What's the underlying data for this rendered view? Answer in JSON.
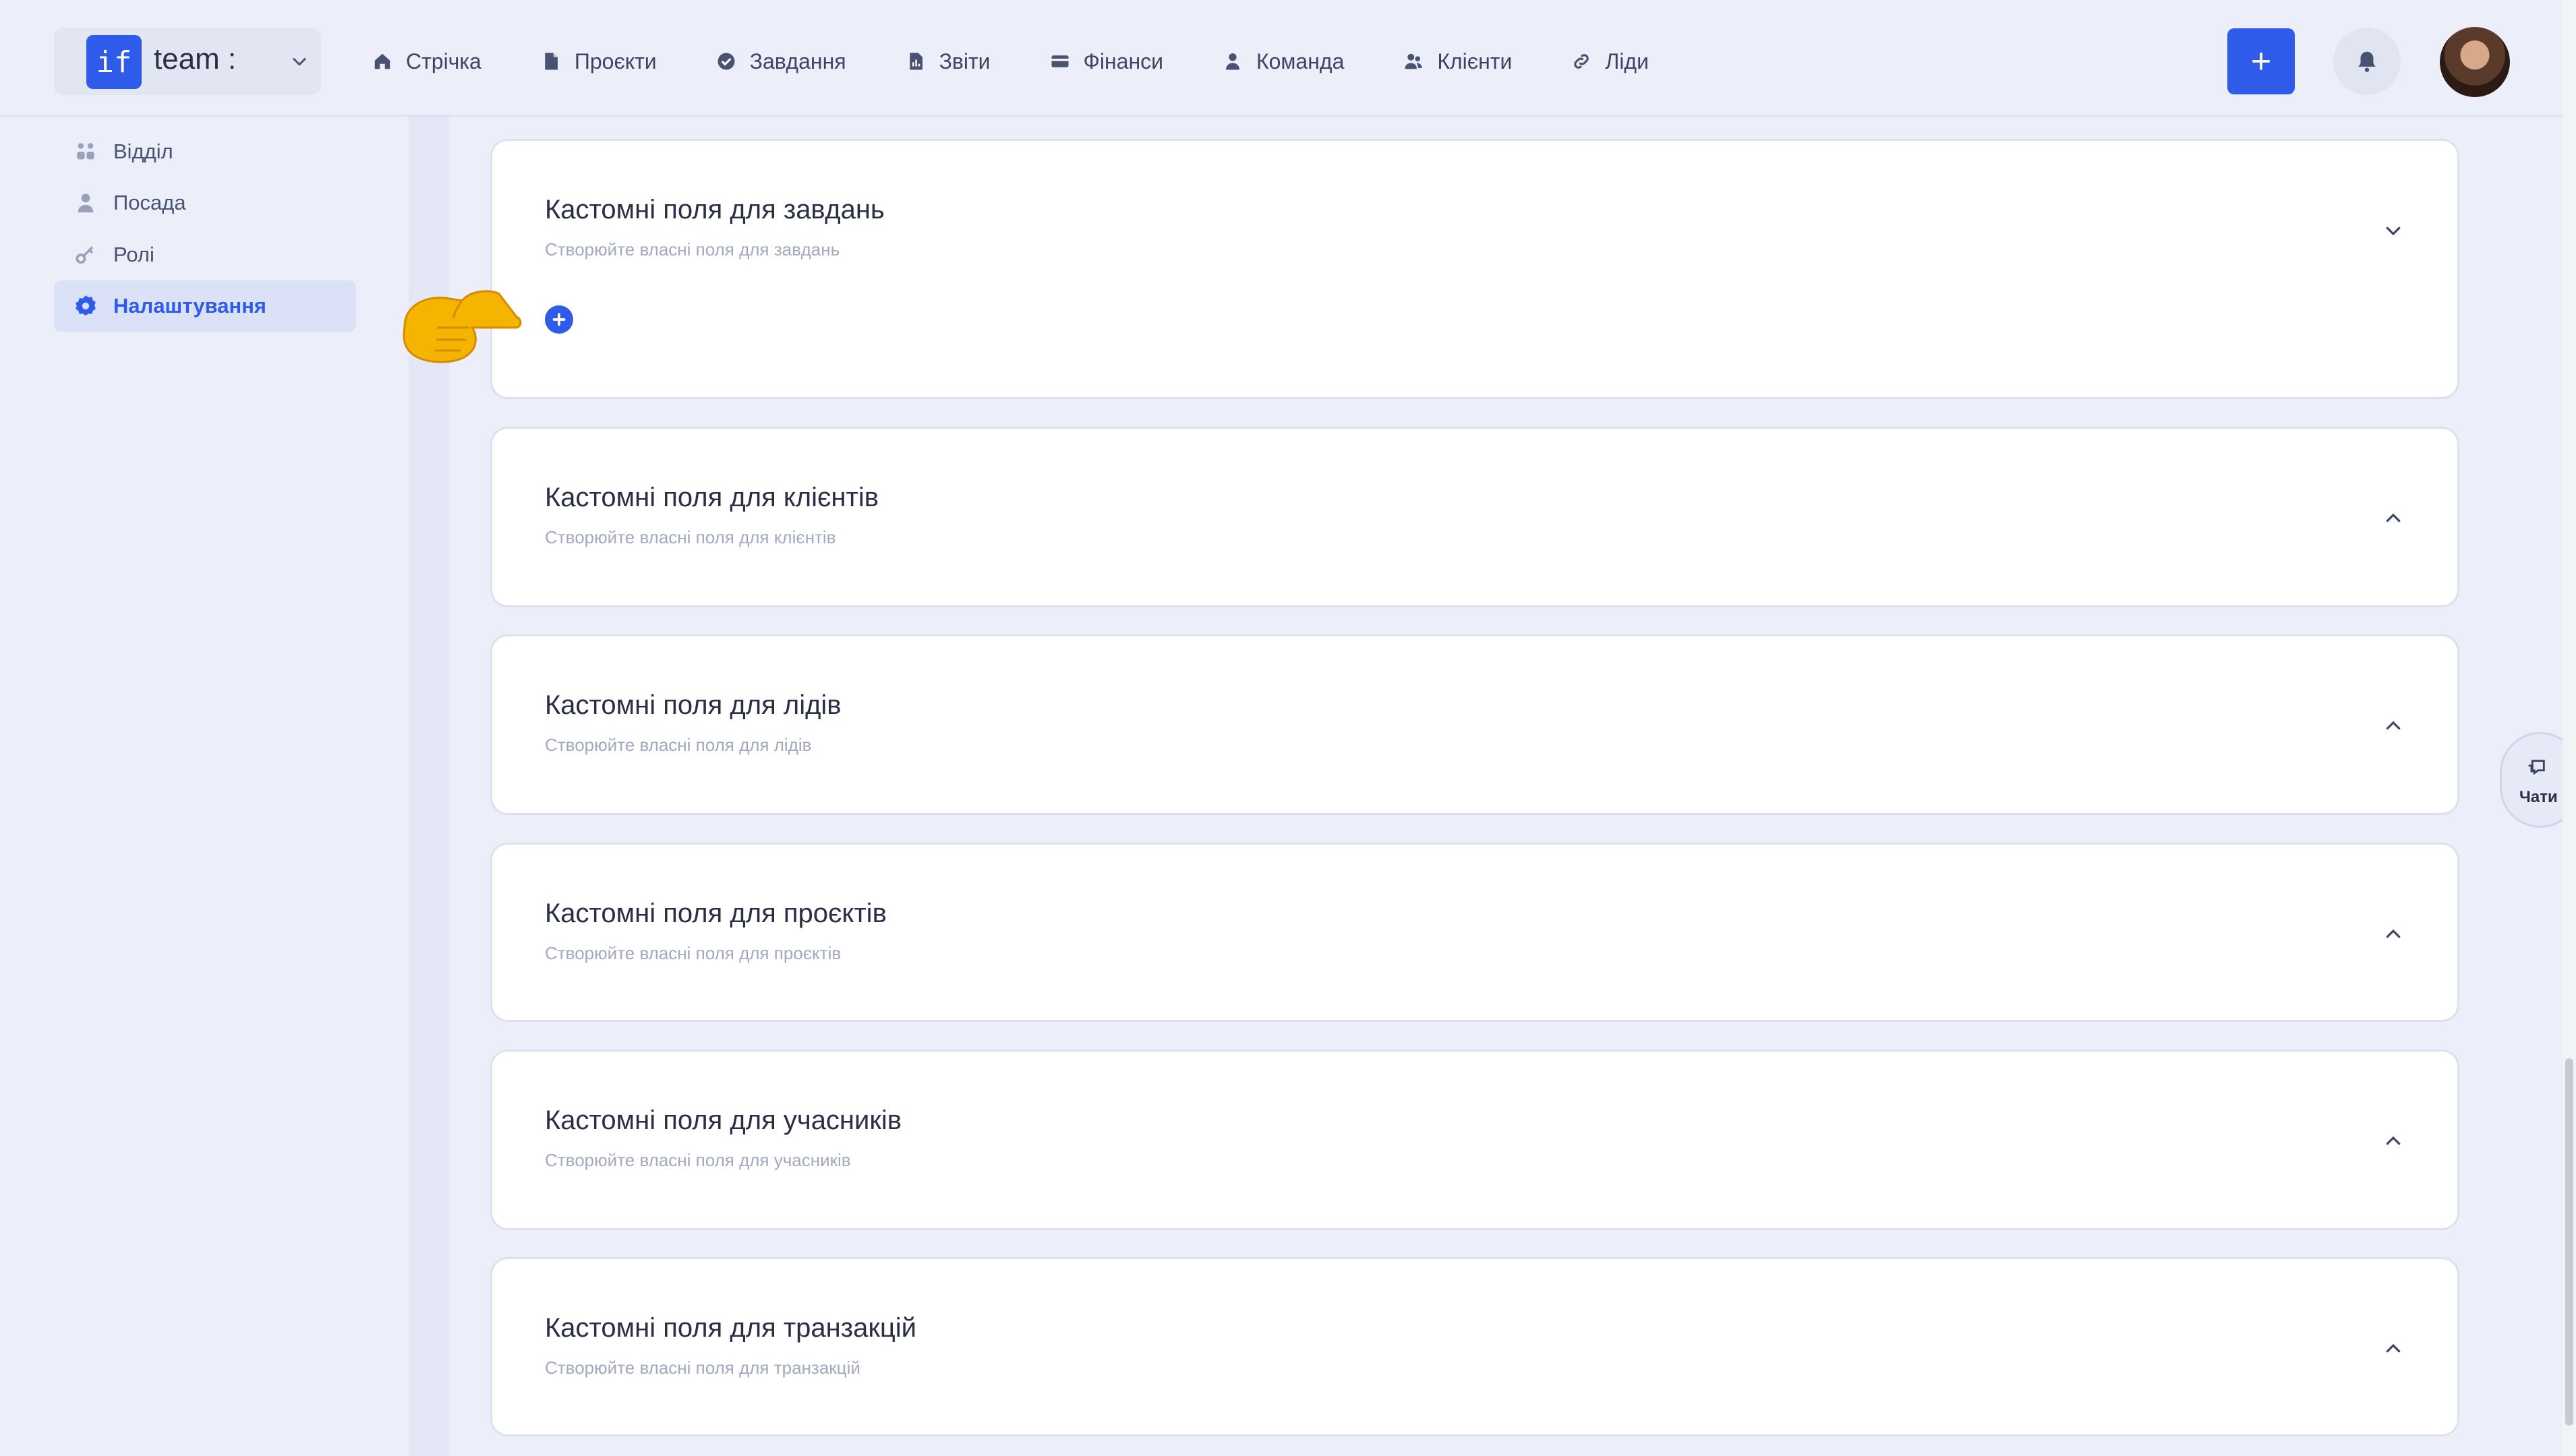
{
  "brand": {
    "logo": "if",
    "name": "team :"
  },
  "nav": [
    {
      "label": "Стрічка",
      "icon": "home-icon"
    },
    {
      "label": "Проєкти",
      "icon": "document-icon"
    },
    {
      "label": "Завдання",
      "icon": "check-circle-icon"
    },
    {
      "label": "Звіти",
      "icon": "report-icon"
    },
    {
      "label": "Фінанси",
      "icon": "wallet-icon"
    },
    {
      "label": "Команда",
      "icon": "user-icon"
    },
    {
      "label": "Клієнти",
      "icon": "users-icon"
    },
    {
      "label": "Ліди",
      "icon": "link-icon"
    }
  ],
  "header": {
    "add_label": "+",
    "accent": "#2f5bea"
  },
  "sidebar": {
    "items": [
      {
        "label": "Відділ",
        "icon": "grid-users-icon",
        "active": false
      },
      {
        "label": "Посада",
        "icon": "user-icon",
        "active": false
      },
      {
        "label": "Ролі",
        "icon": "key-icon",
        "active": false
      },
      {
        "label": "Налаштування",
        "icon": "gear-icon",
        "active": true
      }
    ]
  },
  "cards": [
    {
      "title": "Кастомні поля для завдань",
      "subtitle": "Створюйте власні поля для завдань",
      "expanded": true
    },
    {
      "title": "Кастомні поля для клієнтів",
      "subtitle": "Створюйте власні поля для клієнтів",
      "expanded": false
    },
    {
      "title": "Кастомні поля для лідів",
      "subtitle": "Створюйте власні поля для лідів",
      "expanded": false
    },
    {
      "title": "Кастомні поля для проєктів",
      "subtitle": "Створюйте власні поля для проєктів",
      "expanded": false
    },
    {
      "title": "Кастомні поля для учасників",
      "subtitle": "Створюйте власні поля для учасників",
      "expanded": false
    },
    {
      "title": "Кастомні поля для транзакцій",
      "subtitle": "Створюйте власні поля для транзакцій",
      "expanded": false
    }
  ],
  "chat": {
    "label": "Чати",
    "icon": "chat-icon"
  }
}
